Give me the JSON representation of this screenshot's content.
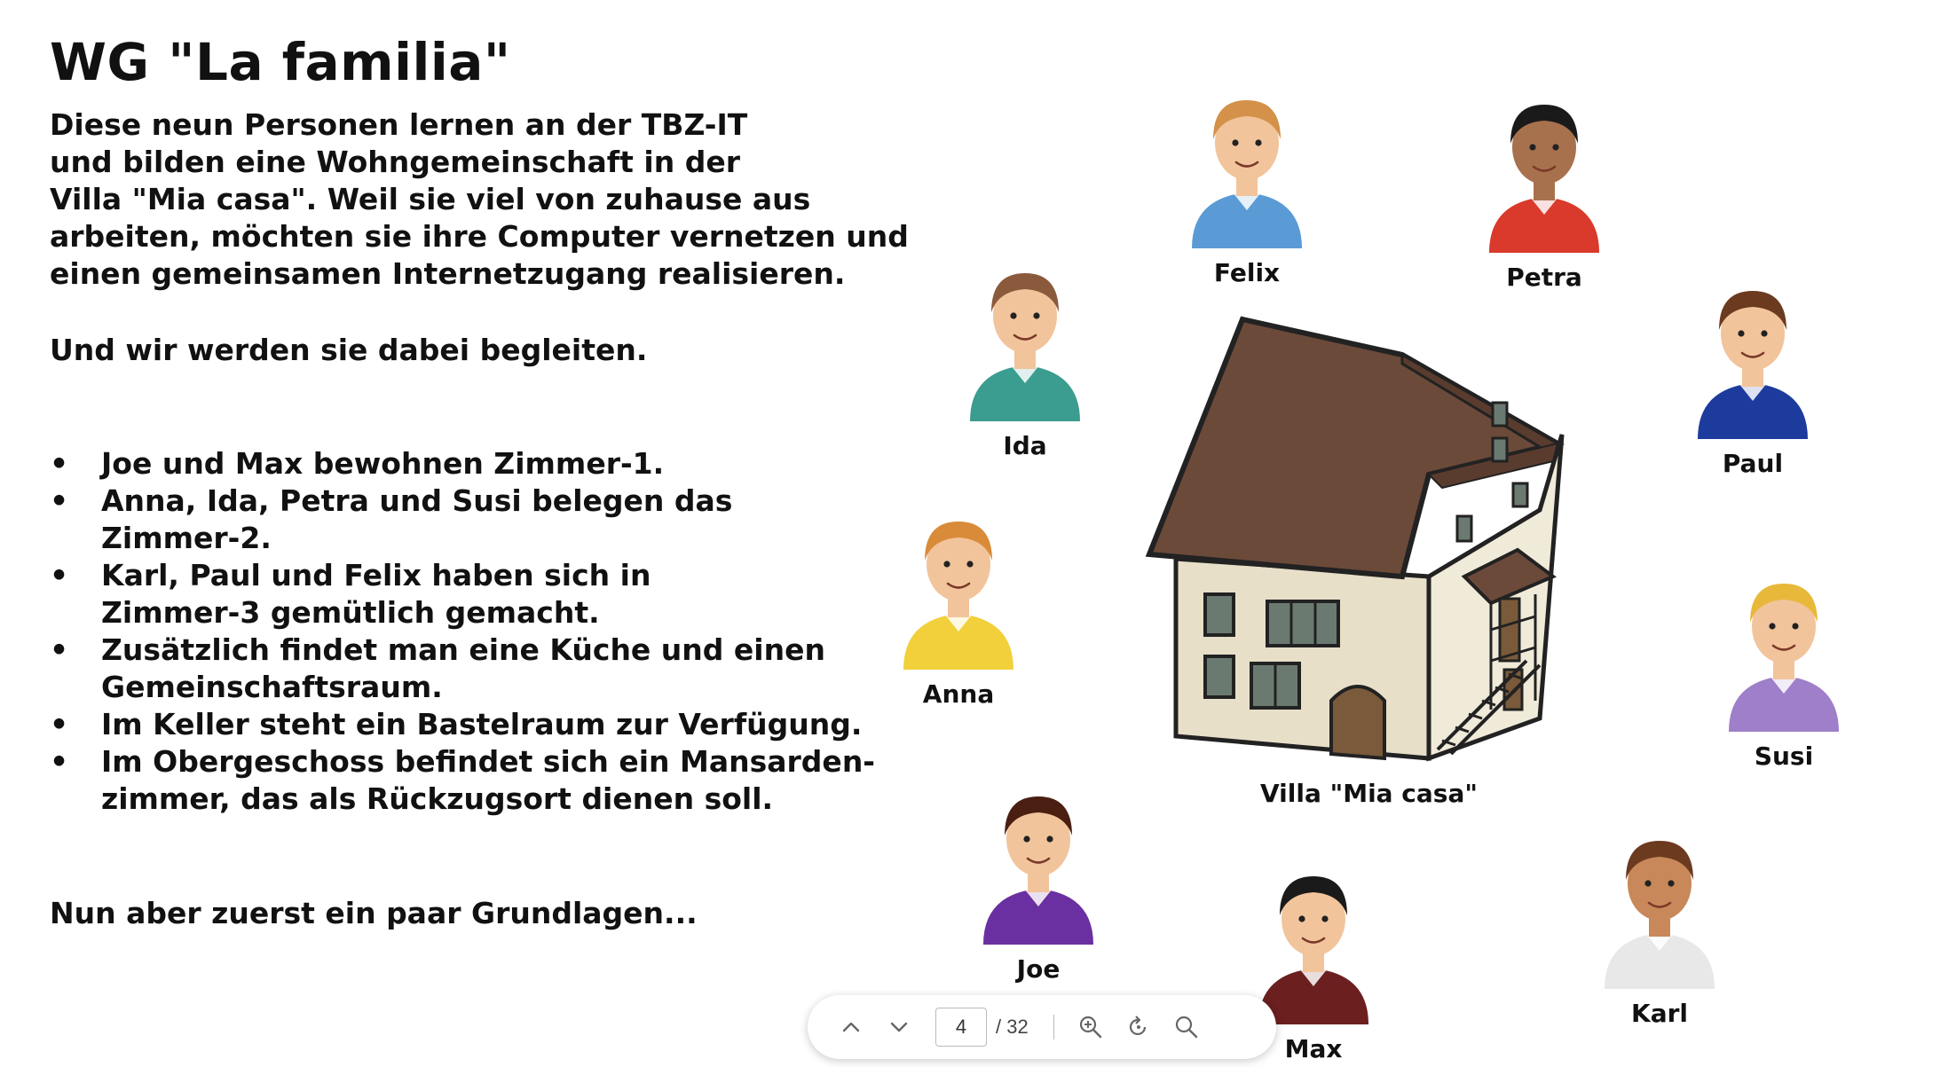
{
  "slide": {
    "title": "WG \"La familia\"",
    "intro_lines": [
      "Diese neun Personen lernen an der TBZ-IT",
      "und bilden eine Wohngemeinschaft in der",
      "Villa \"Mia casa\". Weil sie viel von zuhause aus",
      "arbeiten, möchten sie ihre Computer vernetzen und",
      "einen gemeinsamen Internetzugang realisieren."
    ],
    "follow_text": "Und wir werden sie dabei begleiten.",
    "bullet_char": "•",
    "bullets": [
      [
        "Joe und Max bewohnen Zimmer-1."
      ],
      [
        "Anna, Ida, Petra und Susi belegen das",
        "Zimmer-2."
      ],
      [
        "Karl, Paul und Felix haben sich in",
        "Zimmer-3 gemütlich gemacht."
      ],
      [
        "Zusätzlich findet man eine Küche und einen",
        "Gemeinschaftsraum."
      ],
      [
        "Im Keller steht ein Bastelraum zur Verfügung."
      ],
      [
        "Im Obergeschoss befindet sich ein Mansarden-",
        "zimmer, das als Rückzugsort dienen soll."
      ]
    ],
    "closing_text": "Nun aber zuerst ein paar Grundlagen..."
  },
  "scene": {
    "house_label": "Villa \"Mia casa\"",
    "people": {
      "felix": {
        "name": "Felix",
        "shirt": "#5b9bd5",
        "hair": "#d4914a",
        "skin": "#f2c49b"
      },
      "petra": {
        "name": "Petra",
        "shirt": "#d93a2b",
        "hair": "#1a1a1a",
        "skin": "#a8714d"
      },
      "ida": {
        "name": "Ida",
        "shirt": "#3a9d8f",
        "hair": "#8b5a3c",
        "skin": "#f2c49b"
      },
      "paul": {
        "name": "Paul",
        "shirt": "#1d3b9c",
        "hair": "#6b3a1f",
        "skin": "#f2c49b"
      },
      "anna": {
        "name": "Anna",
        "shirt": "#f2d03b",
        "hair": "#d98b3a",
        "skin": "#f2c49b"
      },
      "susi": {
        "name": "Susi",
        "shirt": "#9f7fc9",
        "hair": "#e8b83a",
        "skin": "#f2c49b"
      },
      "joe": {
        "name": "Joe",
        "shirt": "#6a2fa0",
        "hair": "#4a1f12",
        "skin": "#f2c49b"
      },
      "max": {
        "name": "Max",
        "shirt": "#6b1f1f",
        "hair": "#1a1a1a",
        "skin": "#f2c49b"
      },
      "karl": {
        "name": "Karl",
        "shirt": "#e8e8e8",
        "hair": "#6b3a1f",
        "skin": "#c8885a"
      }
    }
  },
  "pdf_toolbar": {
    "current_page": "4",
    "total_pages": "/ 32"
  }
}
